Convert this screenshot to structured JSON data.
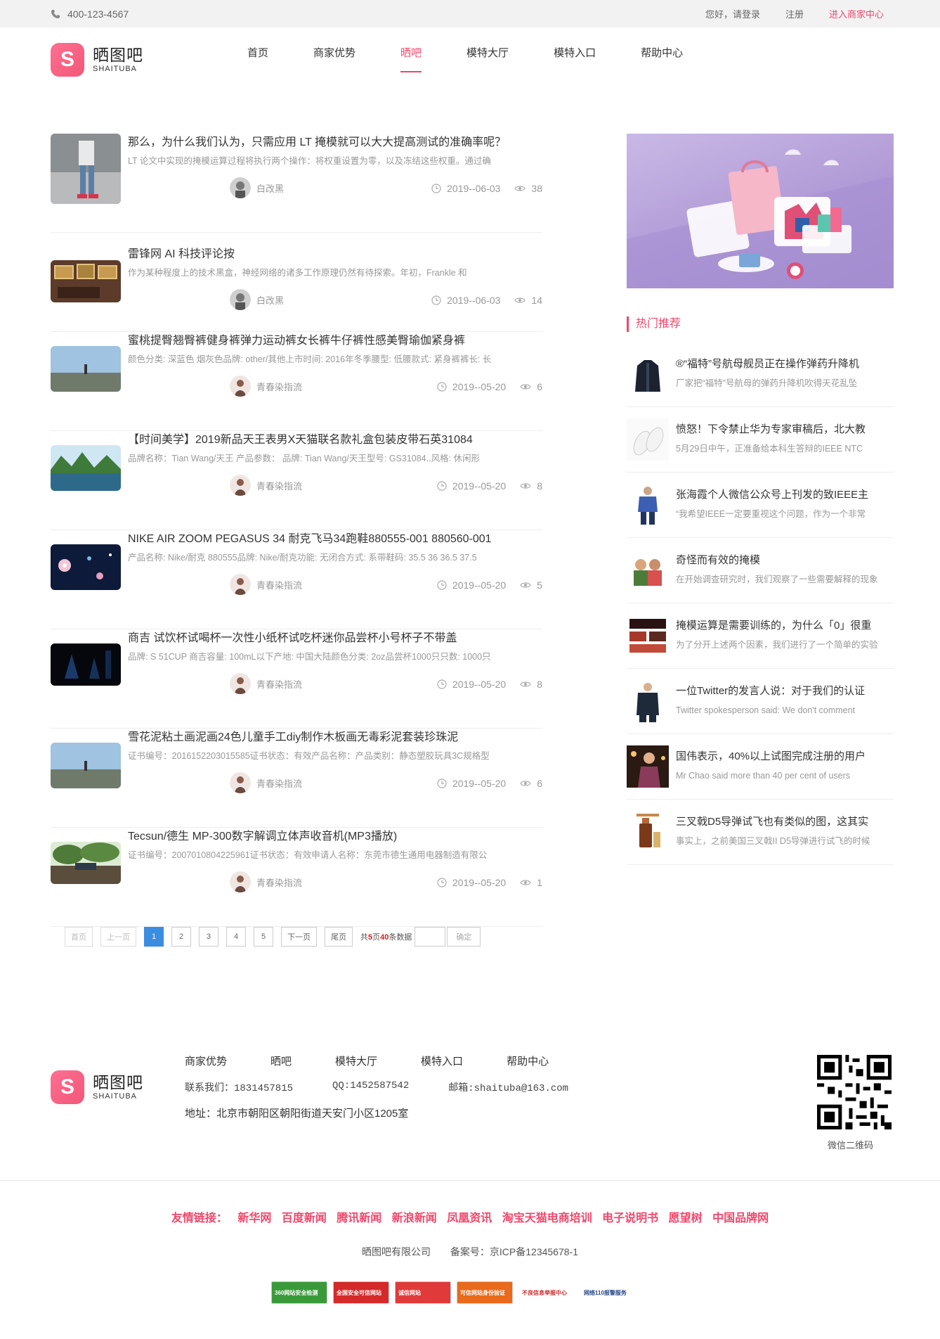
{
  "topbar": {
    "phone": "400-123-4567",
    "greeting": "您好，请登录",
    "register": "注册",
    "merchant": "进入商家中心"
  },
  "header": {
    "logo_cn": "晒图吧",
    "logo_en": "SHAITUBA",
    "nav": [
      "首页",
      "商家优势",
      "晒吧",
      "模特大厅",
      "模特入口",
      "帮助中心"
    ]
  },
  "articles": [
    {
      "title": "那么，为什么我们认为，只需应用 LT 掩模就可以大大提高测试的准确率呢？",
      "desc": "LT 论文中实现的掩模运算过程将执行两个操作：将权重设置为零，以及冻结这些权重。通过确",
      "author": "白改黑",
      "date": "2019--06-03",
      "views": "38"
    },
    {
      "title": "雷锋网 AI 科技评论按",
      "desc": "作为某种程度上的技术黑盒，神经网络的诸多工作原理仍然有待探索。年初，Frankle 和",
      "author": "白改黑",
      "date": "2019--06-03",
      "views": "14"
    },
    {
      "title": "蜜桃提臀翘臀裤健身裤弹力运动裤女长裤牛仔裤性感美臀瑜伽紧身裤",
      "desc": "颜色分类: 深蓝色 烟灰色品牌: other/其他上市时间: 2016年冬季腰型: 低腰款式: 紧身裤裤长: 长",
      "author": "青春染指流",
      "date": "2019--05-20",
      "views": "6"
    },
    {
      "title": "【时间美学】2019新品天王表男X天猫联名款礼盒包装皮带石英31084",
      "desc": "品牌名称：Tian Wang/天王 产品参数： 品牌: Tian Wang/天王型号: GS31084..风格: 休闲形",
      "author": "青春染指流",
      "date": "2019--05-20",
      "views": "8"
    },
    {
      "title": "NIKE AIR ZOOM PEGASUS 34 耐克飞马34跑鞋880555-001 880560-001",
      "desc": "产品名称: Nike/耐克 880555品牌: Nike/耐克功能: 无闭合方式: 系带鞋码: 35.5 36 36.5 37.5",
      "author": "青春染指流",
      "date": "2019--05-20",
      "views": "5"
    },
    {
      "title": "商吉 试饮杯试喝杯一次性小纸杯试吃杯迷你品尝杯小号杯子不带盖",
      "desc": "品牌: S 51CUP 商吉容量: 100mL以下产地: 中国大陆颜色分类: 2oz品尝杯1000只只数: 1000只",
      "author": "青春染指流",
      "date": "2019--05-20",
      "views": "8"
    },
    {
      "title": "雪花泥粘土画泥画24色儿童手工diy制作木板画无毒彩泥套装珍珠泥",
      "desc": "证书编号：2016152203015585证书状态：有效产品名称：产品类别：静态塑胶玩具3C规格型",
      "author": "青春染指流",
      "date": "2019--05-20",
      "views": "6"
    },
    {
      "title": "Tecsun/德生 MP-300数字解调立体声收音机(MP3播放)",
      "desc": "证书编号：2007010804225961证书状态：有效申请人名称：东莞市德生通用电器制造有限公",
      "author": "青春染指流",
      "date": "2019--05-20",
      "views": "1"
    }
  ],
  "pagination": {
    "first": "首页",
    "prev": "上一页",
    "pages": [
      "1",
      "2",
      "3",
      "4",
      "5"
    ],
    "next": "下一页",
    "last": "尾页",
    "info_prefix": "共",
    "total_pages": "5",
    "info_mid": "页",
    "total_records": "40",
    "info_suffix": "条数据",
    "confirm": "确定"
  },
  "sidebar": {
    "hot_title": "热门推荐",
    "hot": [
      {
        "title": "®“福特”号航母舰员正在操作弹药升降机",
        "desc": "厂家把“福特”号航母的弹药升降机吹得天花乱坠"
      },
      {
        "title": "愤怒！下令禁止华为专家审稿后，北大教",
        "desc": "5月29日中午，正准备给本科生答辩的IEEE NTC"
      },
      {
        "title": "张海霞个人微信公众号上刊发的致IEEE主",
        "desc": "“我希望IEEE一定要重视这个问题，作为一个非常"
      },
      {
        "title": "奇怪而有效的掩模",
        "desc": "在开始调查研究时，我们观察了一些需要解释的现象"
      },
      {
        "title": "掩模运算是需要训练的，为什么「0」很重",
        "desc": "为了分开上述两个因素，我们进行了一个简单的实验"
      },
      {
        "title": "一位Twitter的发言人说：对于我们的认证",
        "desc": "Twitter spokesperson said: We don't comment"
      },
      {
        "title": "国伟表示，40%以上试图完成注册的用户",
        "desc": "Mr Chao said more than 40 per cent of users"
      },
      {
        "title": "三叉戟D5导弹试飞也有类似的图，这其实",
        "desc": "事实上，之前美国三叉戟II D5导弹进行试飞的时候"
      }
    ]
  },
  "footer": {
    "logo_cn": "晒图吧",
    "logo_en": "SHAITUBA",
    "nav": [
      "商家优势",
      "晒吧",
      "模特大厅",
      "模特入口",
      "帮助中心"
    ],
    "contact_phone": "联系我们：1831457815",
    "contact_qq": "QQ:1452587542",
    "contact_email": "邮箱:shaituba@163.com",
    "address": "地址：北京市朝阳区朝阳街道天安门小区1205室",
    "qr_label": "微信二维码",
    "friend_label": "友情链接：",
    "friends": [
      "新华网",
      "百度新闻",
      "腾讯新闻",
      "新浪新闻",
      "凤凰资讯",
      "淘宝天猫电商培训",
      "电子说明书",
      "愿望树",
      "中国品牌网"
    ],
    "company": "晒图吧有限公司",
    "icp": "备案号：京ICP备12345678-1",
    "badges": [
      "360网站安全检测",
      "全国安全可信网站",
      "诚信网站",
      "可信网站身份验证",
      "不良信息举报中心",
      "网络110报警服务"
    ]
  },
  "colors": {
    "accent": "#f0476b",
    "page_current": "#3b8de0"
  }
}
